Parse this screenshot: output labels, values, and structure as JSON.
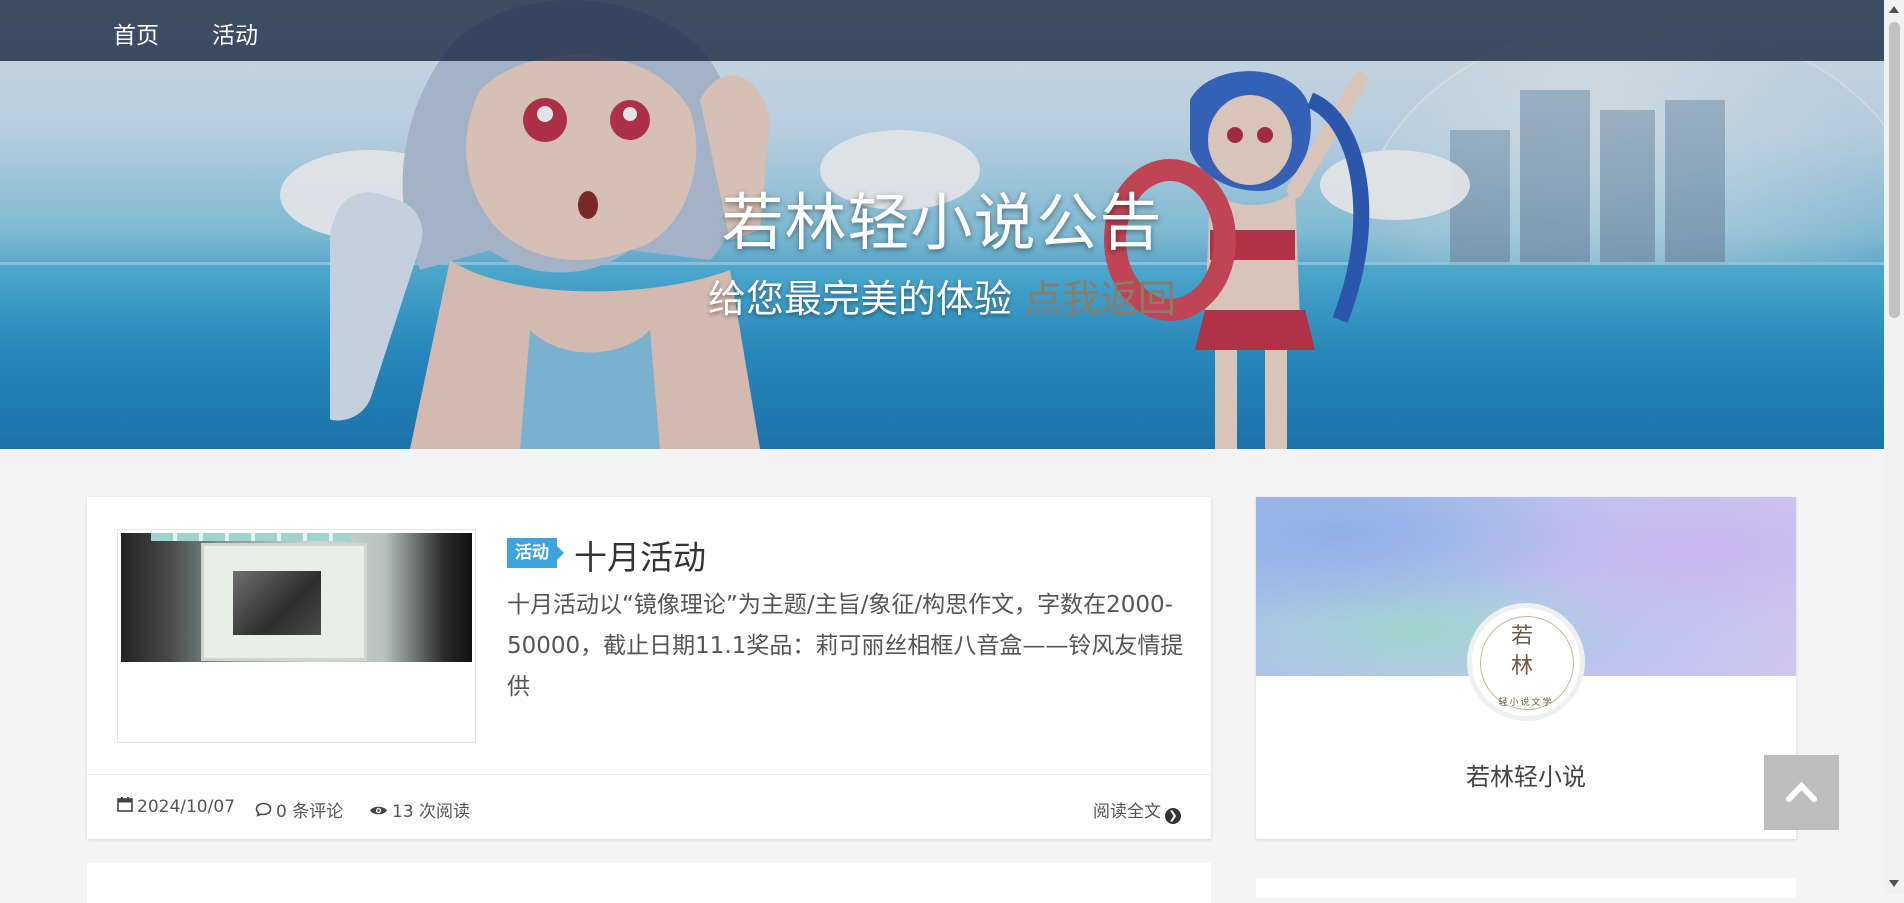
{
  "nav": {
    "items": [
      {
        "label": "首页"
      },
      {
        "label": "活动"
      }
    ]
  },
  "hero": {
    "title": "若林轻小说公告",
    "subtitle": "给您最完美的体验",
    "back_link": "点我返回"
  },
  "post": {
    "tag": "活动",
    "title": "十月活动",
    "excerpt": "十月活动以“镜像理论”为主题/主旨/象征/构思作文，字数在2000-50000，截止日期11.1奖品：莉可丽丝相框八音盒——铃风友情提供",
    "date": "2024/10/07",
    "comments": "0 条评论",
    "views": "13 次阅读",
    "read_more": "阅读全文",
    "thumb_alt": "帖子配图"
  },
  "sidebar": {
    "site_name": "若林轻小说",
    "logo_chars": "若林",
    "logo_sub": "轻小说文学"
  },
  "icons": {
    "calendar": "calendar-icon",
    "comment": "comment-icon",
    "eye": "eye-icon",
    "arrow": "chevron-right-circle-icon",
    "back_top": "chevron-up-icon"
  },
  "colors": {
    "nav_bg": "#1e2d46",
    "tag_bg": "#3fa3e0",
    "back_top_bg": "#bdbdbd",
    "page_bg": "#f4f4f4"
  }
}
